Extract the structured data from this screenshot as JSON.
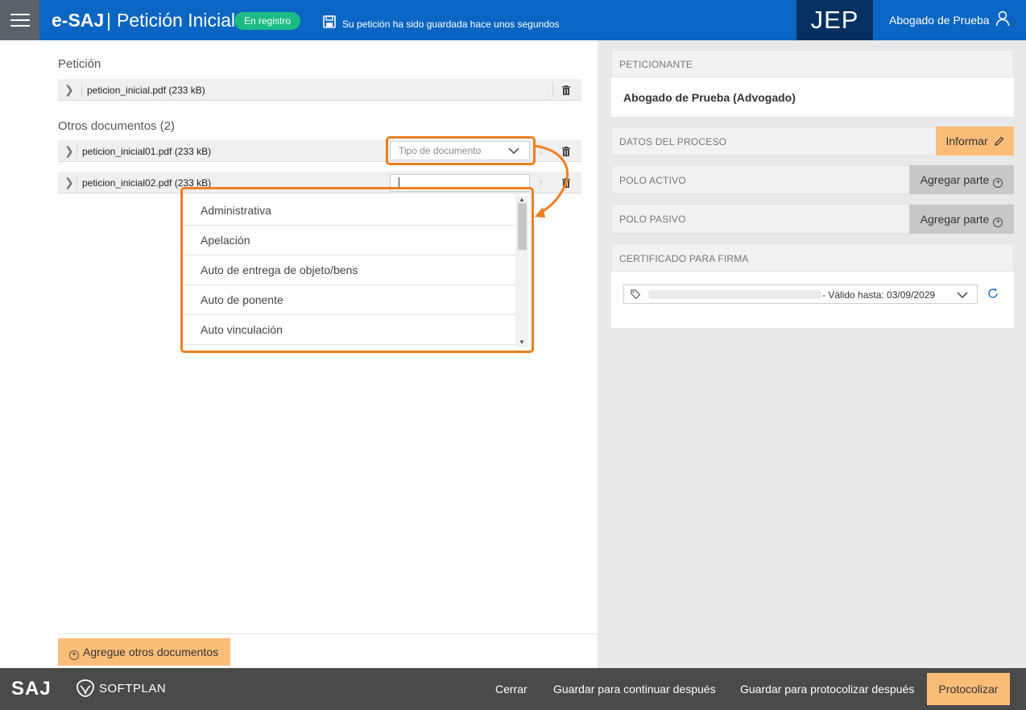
{
  "header": {
    "brand": "e-SAJ",
    "separator": "|",
    "page_title": "Petición Inicial",
    "status_badge": "En registro",
    "save_message": "Su petición ha sido guardada hace unos segundos",
    "court_code": "JEP",
    "user_name": "Abogado de Prueba"
  },
  "left": {
    "peticion_title": "Petición",
    "main_file": "peticion_inicial.pdf (233 kB)",
    "otros_title": "Otros documentos (2)",
    "other_files": [
      {
        "name": "peticion_inicial01.pdf (233 kB)",
        "doc_type_placeholder": "Tipo de documento"
      },
      {
        "name": "peticion_inicial02.pdf (233 kB)",
        "doc_type_value": ""
      }
    ],
    "dropdown_options": [
      "Administrativa",
      "Apelación",
      "Auto de entrega de objeto/bens",
      "Auto de ponente",
      "Auto vinculación"
    ],
    "add_docs_button": "Agregue otros documentos"
  },
  "right": {
    "peticionante_header": "PETICIONANTE",
    "peticionante_name": "Abogado de Prueba (Advogado)",
    "datos_header": "DATOS DEL PROCESO",
    "informar_button": "Informar",
    "polo_activo_header": "POLO ACTIVO",
    "polo_pasivo_header": "POLO PASIVO",
    "agregar_parte_button": "Agregar parte",
    "certificado_header": "CERTIFICADO PARA FIRMA",
    "cert_valid": "- Válido hasta: 03/09/2029"
  },
  "footer": {
    "saj_logo": "SAJ",
    "softplan_logo": "SOFTPLAN",
    "cerrar": "Cerrar",
    "guardar_continuar": "Guardar para continuar después",
    "guardar_protocolizar": "Guardar para protocolizar después",
    "protocolizar": "Protocolizar"
  },
  "colors": {
    "header_blue": "#0a66c2",
    "court_navy": "#06305f",
    "status_green": "#1abc84",
    "accent_orange": "#fcbd78",
    "highlight_orange": "#ee7f22",
    "footer_grey": "#4a4a4a"
  }
}
